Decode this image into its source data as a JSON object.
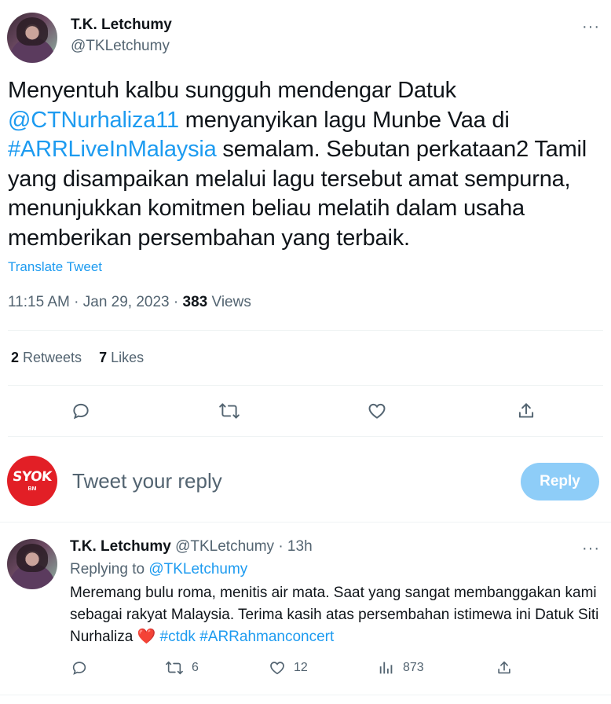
{
  "tweet": {
    "author_name": "T.K. Letchumy",
    "author_handle": "@TKLetchumy",
    "text_1": "Menyentuh kalbu sungguh mendengar Datuk",
    "mention": "@CTNurhaliza11",
    "text_2": " menyanyikan lagu Munbe Vaa di",
    "hashtag": "#ARRLiveInMalaysia",
    "text_3": " semalam. Sebutan perkataan2 Tamil yang disampaikan melalui lagu tersebut amat sempurna, menunjukkan komitmen beliau melatih dalam usaha memberikan persembahan yang terbaik.",
    "translate_label": "Translate Tweet",
    "time": "11:15 AM · Jan 29, 2023 · ",
    "views_count": "383",
    "views_label": " Views",
    "retweets_count": "2",
    "retweets_label": " Retweets",
    "likes_count": "7",
    "likes_label": " Likes",
    "icons": [
      "reply-icon",
      "retweet-icon",
      "like-icon",
      "share-icon",
      "more-icon"
    ]
  },
  "compose": {
    "avatar_text": "SYOK",
    "avatar_sub": "BM",
    "placeholder": "Tweet your reply",
    "reply_button": "Reply",
    "button_color": "#8ecdf8"
  },
  "reply": {
    "author_name": "T.K. Letchumy",
    "author_handle": "@TKLetchumy",
    "age": " · 13h",
    "replying_to_label": "Replying to ",
    "replying_to_handle": "@TKLetchumy",
    "text": "Meremang bulu roma, menitis air mata. Saat yang sangat membanggakan kami sebagai rakyat Malaysia. Terima kasih atas persembahan istimewa ini Datuk Siti Nurhaliza ",
    "heart": "❤️",
    "hashtag_1": "#ctdk",
    "hashtag_2": "#ARRahmanconcert",
    "retweets": "6",
    "likes": "12",
    "views": "873"
  },
  "colors": {
    "accent": "#1d9bf0",
    "text": "#0f1419",
    "muted": "#536471",
    "heart": "#e0245e"
  }
}
